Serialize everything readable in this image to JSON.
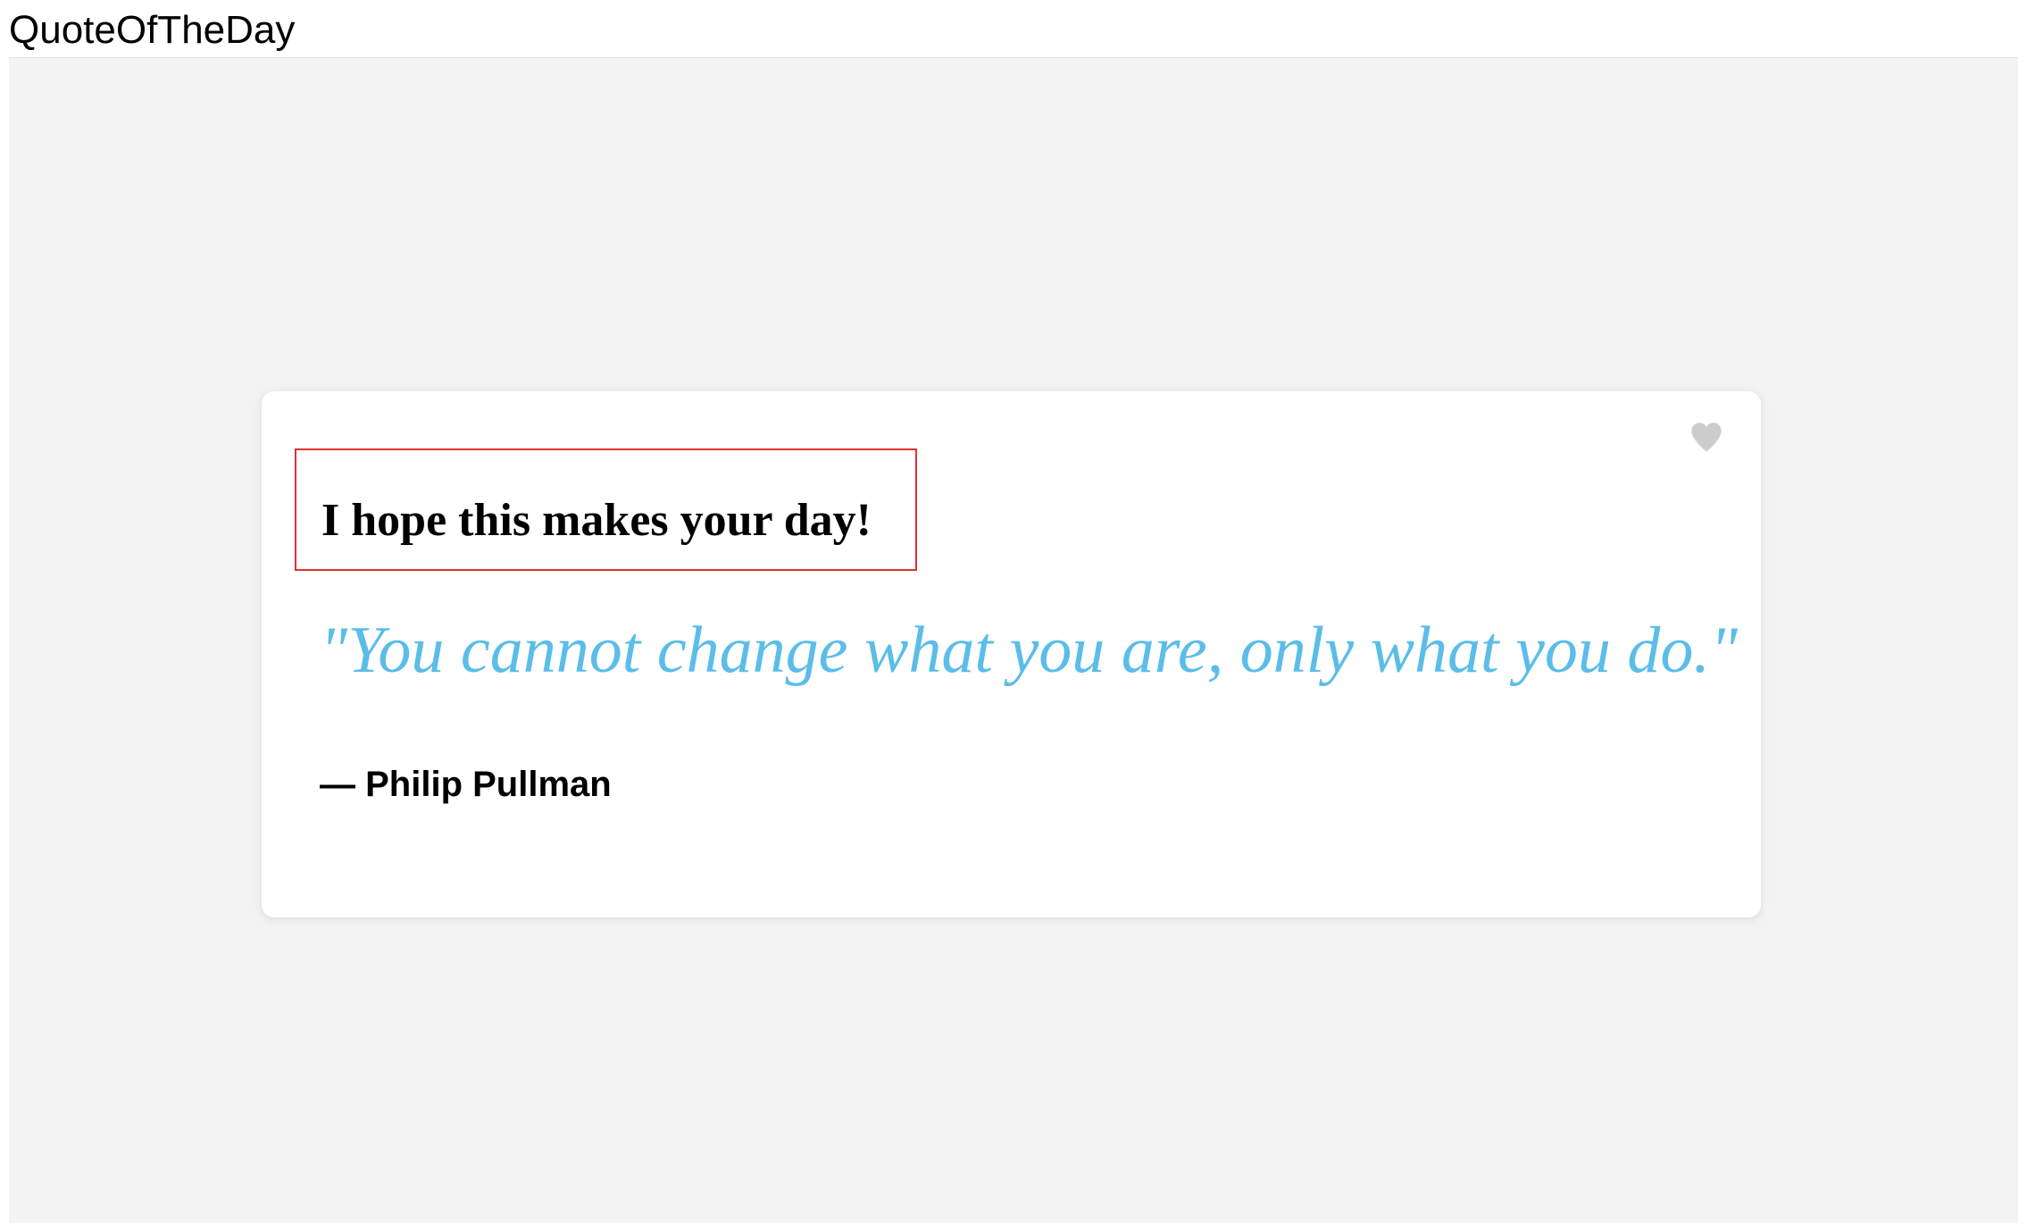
{
  "app": {
    "title": "QuoteOfTheDay"
  },
  "card": {
    "greeting": "I hope this makes your day!",
    "quote": "\"You cannot change what you are, only what you do.\"",
    "author": "— Philip Pullman",
    "favorite_icon": "heart-icon"
  },
  "colors": {
    "quote_text": "#5bbde8",
    "greeting_border": "#e03030",
    "heart_icon": "#cccccc",
    "background": "#f3f3f3"
  }
}
